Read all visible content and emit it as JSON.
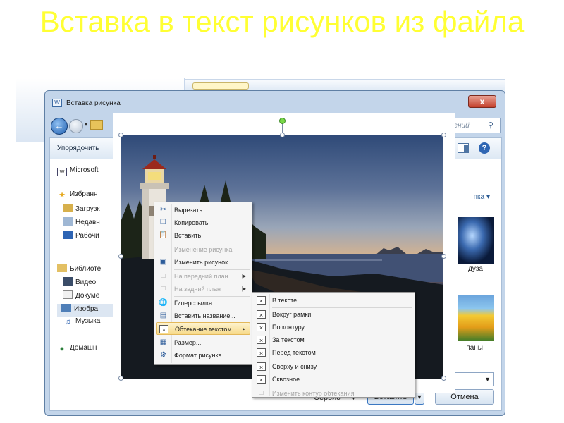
{
  "slide": {
    "title": "Вставка в текст рисунков из файла"
  },
  "dialog": {
    "title": "Вставка рисунка",
    "close_label": "x",
    "search_placeholder": "ажений",
    "organize_label": "Упорядочить",
    "nav": {
      "items": [
        {
          "label": "Microsoft",
          "icon": "word-icon"
        },
        {
          "label": "Избранн",
          "icon": "star-icon"
        },
        {
          "label": "Загрузк",
          "icon": "downloads-icon"
        },
        {
          "label": "Недавн",
          "icon": "recent-icon"
        },
        {
          "label": "Рабочи",
          "icon": "desktop-icon"
        },
        {
          "label": "Библиоте",
          "icon": "library-icon"
        },
        {
          "label": "Видео",
          "icon": "video-icon"
        },
        {
          "label": "Докуме",
          "icon": "documents-icon"
        },
        {
          "label": "Изобра",
          "icon": "pictures-icon"
        },
        {
          "label": "Музыка",
          "icon": "music-icon"
        },
        {
          "label": "Домашн",
          "icon": "homegroup-icon"
        }
      ]
    },
    "sort_label": "пка ▾",
    "files": [
      {
        "label": "дуза"
      },
      {
        "label": "паны"
      }
    ],
    "service_label": "Сервис",
    "insert_label": "Вставить",
    "cancel_label": "Отмена",
    "colors": {
      "accent": "#3b78c2",
      "title_yellow": "#ffff33",
      "close_red": "#c4412d"
    }
  },
  "context_menu": {
    "items": [
      {
        "label": "Вырезать",
        "icon": "scissors-icon"
      },
      {
        "label": "Копировать",
        "icon": "copy-icon"
      },
      {
        "label": "Вставить",
        "icon": "paste-icon"
      },
      {
        "label": "Изменение рисунка",
        "icon": ""
      },
      {
        "label": "Изменить рисунок...",
        "icon": "change-picture-icon"
      },
      {
        "label": "На передний план",
        "icon": "bring-forward-icon"
      },
      {
        "label": "На задний план",
        "icon": "send-backward-icon"
      },
      {
        "label": "Гиперссылка...",
        "icon": "hyperlink-icon"
      },
      {
        "label": "Вставить название...",
        "icon": "caption-icon"
      },
      {
        "label": "Обтекание текстом",
        "icon": "text-wrap-icon"
      },
      {
        "label": "Размер...",
        "icon": "size-icon"
      },
      {
        "label": "Формат рисунка...",
        "icon": "format-picture-icon"
      }
    ]
  },
  "wrap_submenu": {
    "items": [
      {
        "label": "В тексте"
      },
      {
        "label": "Вокруг рамки"
      },
      {
        "label": "По контуру"
      },
      {
        "label": "За текстом"
      },
      {
        "label": "Перед текстом"
      },
      {
        "label": "Сверху и снизу"
      },
      {
        "label": "Сквозное"
      },
      {
        "label": "Изменить контур обтекания"
      }
    ]
  }
}
